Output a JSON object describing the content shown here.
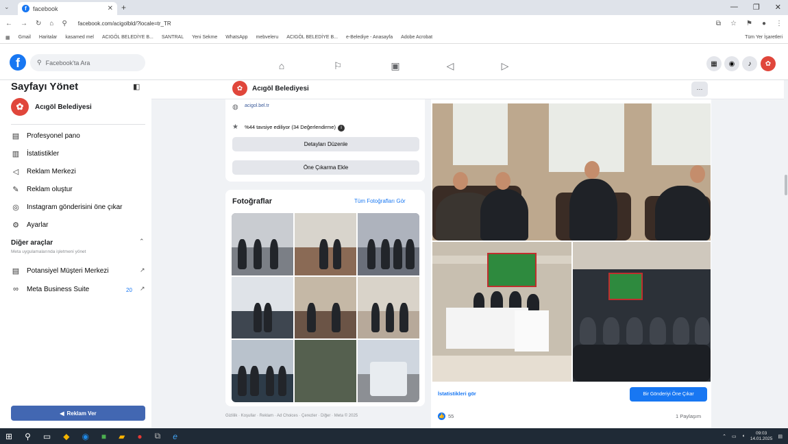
{
  "browser": {
    "tab_title": "facebook",
    "url": "facebook.com/acigolbld/?locale=tr_TR",
    "bookmarks": [
      "Gmail",
      "Haritalar",
      "kasamed mel",
      "ACIGÖL BELEDİYE B...",
      "SANTRAL",
      "Yeni Sekme",
      "WhatsApp",
      "mebveleru",
      "ACIGÖL BELEDİYE B...",
      "e-Belediye - Anasayfa",
      "Adobe Acrobat"
    ],
    "other_bookmarks": "Tüm Yer İşaretleri"
  },
  "header": {
    "search_placeholder": "Facebook'ta Ara"
  },
  "sidebar": {
    "title": "Sayfayı Yönet",
    "page_name": "Acıgöl Belediyesi",
    "items": [
      {
        "label": "Profesyonel pano",
        "icon": "dashboard-icon"
      },
      {
        "label": "İstatistikler",
        "icon": "insights-icon"
      },
      {
        "label": "Reklam Merkezi",
        "icon": "megaphone-icon"
      },
      {
        "label": "Reklam oluştur",
        "icon": "edit-icon"
      },
      {
        "label": "Instagram gönderisini öne çıkar",
        "icon": "instagram-icon"
      },
      {
        "label": "Ayarlar",
        "icon": "gear-icon"
      }
    ],
    "other_tools": "Diğer araçlar",
    "other_tools_sub": "Meta uygulamalarında işletmeni yönet",
    "tools": [
      {
        "label": "Potansiyel Müşteri Merkezi",
        "icon": "leads-icon"
      },
      {
        "label": "Meta Business Suite",
        "icon": "meta-icon",
        "badge": "20"
      }
    ],
    "ad_button": "Reklam Ver"
  },
  "page_bar": {
    "name": "Acıgöl Belediyesi",
    "more": "···"
  },
  "intro": {
    "link": "acigol.bel.tr",
    "recommend": "%44 tavsiye ediliyor (34 Değerlendirme)",
    "edit_details": "Detayları Düzenle",
    "add_featured": "Öne Çıkarma Ekle"
  },
  "photos": {
    "title": "Fotoğraflar",
    "see_all": "Tüm Fotoğrafları Gör"
  },
  "footer": "Gizlilik · Koşullar · Reklam · Ad Choices · Çerezler · Diğer · Meta © 2025",
  "post": {
    "insights_link": "İstatistikleri gör",
    "boost_button": "Bir Gönderiyi Öne Çıkar",
    "reactions": "55",
    "shares": "1 Paylaşım"
  },
  "taskbar": {
    "time": "09:03",
    "date": "14.01.2025"
  },
  "colors": {
    "fb_blue": "#1877f2",
    "page_avatar": "#e0463b",
    "taskbar": "#1f2a36"
  }
}
